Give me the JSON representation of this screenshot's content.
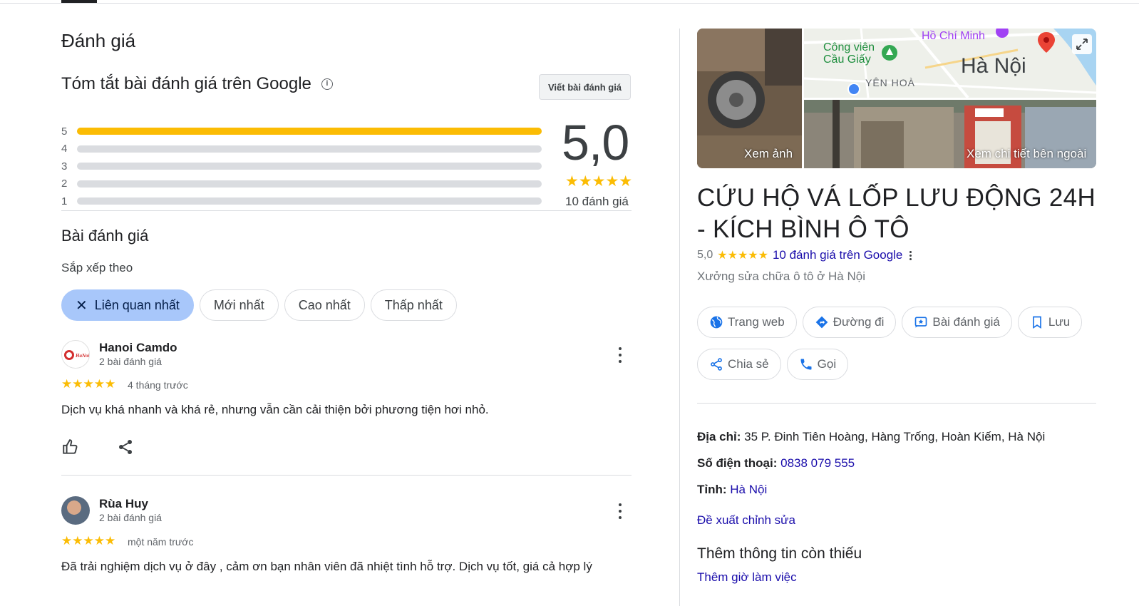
{
  "reviews_section": {
    "title": "Đánh giá",
    "summary_title": "Tóm tắt bài đánh giá trên Google",
    "write_review_label": "Viết bài đánh giá",
    "rating_distribution": [
      {
        "stars": "5",
        "fraction": 1.0
      },
      {
        "stars": "4",
        "fraction": 0.0
      },
      {
        "stars": "3",
        "fraction": 0.0
      },
      {
        "stars": "2",
        "fraction": 0.0
      },
      {
        "stars": "1",
        "fraction": 0.0
      }
    ],
    "average_score": "5,0",
    "average_stars": "★★★★★",
    "review_count": "10 đánh giá",
    "list_title": "Bài đánh giá",
    "sort_label": "Sắp xếp theo",
    "sort_chips": [
      "Liên quan nhất",
      "Mới nhất",
      "Cao nhất",
      "Thấp nhất"
    ],
    "reviews": [
      {
        "author": "Hanoi Camdo",
        "author_meta": "2 bài đánh giá",
        "stars": "★★★★★",
        "time": "4 tháng trước",
        "text": "Dịch vụ khá nhanh và khá rẻ, nhưng vẫn cần cải thiện bởi phương tiện hơi nhỏ."
      },
      {
        "author": "Rùa Huy",
        "author_meta": "2 bài đánh giá",
        "stars": "★★★★★",
        "time": "một năm trước",
        "text": "Đã trải nghiệm dịch vụ ở đây , cảm ơn bạn nhân viên đã nhiệt tình hỗ trợ. Dịch vụ tốt, giá cả hợp lý"
      }
    ]
  },
  "business_panel": {
    "photo_label": "Xem ảnh",
    "street_label": "Xem chi tiết bên ngoài",
    "map_labels": {
      "park": "Công viên\nCầu Giấy",
      "mausoleum": "Hồ Chí Minh",
      "district": "YÊN HOÀ",
      "city": "Hà Nội"
    },
    "name": "CỨU HỘ VÁ LỐP LƯU ĐỘNG 24H - KÍCH BÌNH Ô TÔ",
    "rating": "5,0",
    "rating_stars": "★★★★★",
    "reviews_link": "10 đánh giá trên Google",
    "category": "Xưởng sửa chữa ô tô ở Hà Nội",
    "actions_row1": [
      "Trang web",
      "Đường đi",
      "Bài đánh giá",
      "Lưu"
    ],
    "actions_row2": [
      "Chia sẻ",
      "Gọi"
    ],
    "address_label": "Địa chỉ:",
    "address": " 35 P. Đinh Tiên Hoàng, Hàng Trống, Hoàn Kiếm, Hà Nội",
    "phone_label": "Số điện thoại:",
    "phone": " 0838 079 555",
    "province_label": "Tỉnh:",
    "province": " Hà Nội",
    "suggest_edit": "Đề xuất chỉnh sửa",
    "missing_title": "Thêm thông tin còn thiếu",
    "missing_link": "Thêm giờ làm việc"
  },
  "colors": {
    "star": "#fbbc04",
    "link": "#1a0dab",
    "chip_active": "#a8c7fa"
  }
}
